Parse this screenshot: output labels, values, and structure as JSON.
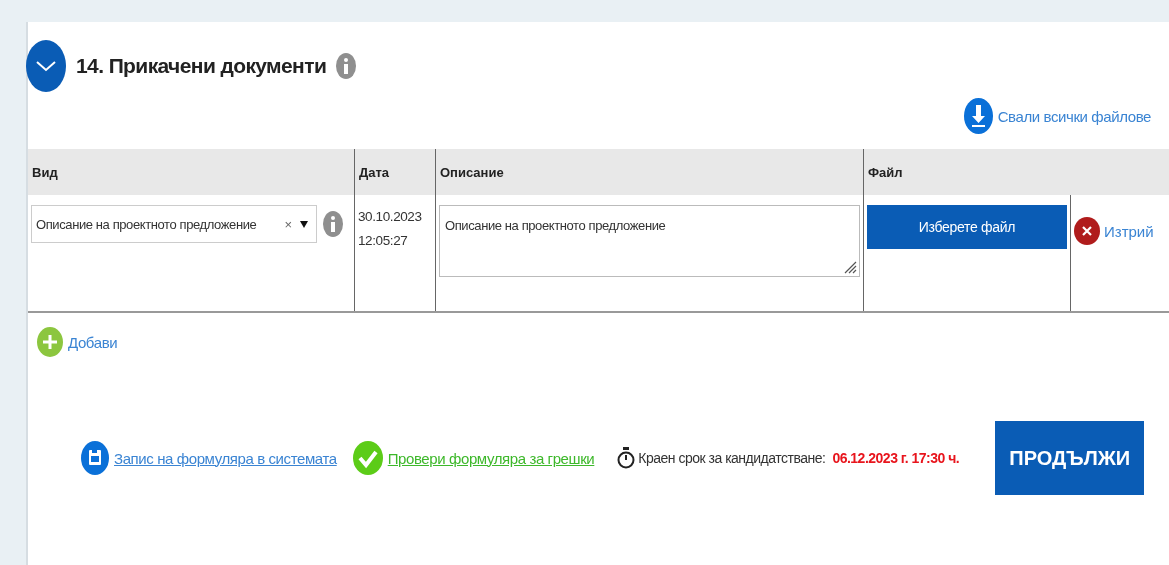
{
  "section": {
    "title": "14. Прикачени документи",
    "expanded": true
  },
  "download_all": {
    "label": "Свали всички файлове"
  },
  "table": {
    "columns": [
      "Вид",
      "Дата",
      "Описание",
      "Файл"
    ],
    "rows": [
      {
        "type": "Описание на проектното предложение",
        "clear": "×",
        "date": "30.10.2023",
        "time": "12:05:27",
        "description": "Описание на проектното предложение",
        "file_button": "Изберете файл",
        "delete": "Изтрий"
      }
    ]
  },
  "add": {
    "label": "Добави"
  },
  "footer": {
    "save_link": "Запис на формуляра в системата",
    "check_link": "Провери формуляра за грешки",
    "deadline_label": "Краен срок за кандидатстване:",
    "deadline_value": "06.12.2023 г. 17:30 ч.",
    "continue_button": "ПРОДЪЛЖИ"
  }
}
